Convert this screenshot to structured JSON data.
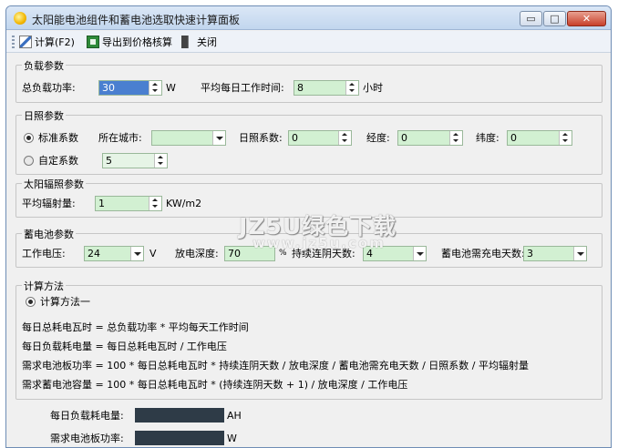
{
  "window": {
    "title": "太阳能电池组件和蓄电池选取快速计算面板"
  },
  "titlebar_buttons": {
    "minimize": "▭",
    "maximize": "□",
    "close": "✕"
  },
  "toolbar": {
    "calc_label": "计算(F2)",
    "export_label": "导出到价格核算",
    "close_label": "关闭",
    "icons": [
      "calculate-icon",
      "excel-icon",
      "exit-icon"
    ]
  },
  "load": {
    "title": "负载参数",
    "power_label": "总负载功率:",
    "power_value": "30",
    "power_unit": "W",
    "hours_label": "平均每日工作时间:",
    "hours_value": "8",
    "hours_unit": "小时"
  },
  "sun": {
    "title": "日照参数",
    "standard_label": "标准系数",
    "city_label": "所在城市:",
    "city_value": "",
    "coef_label": "日照系数:",
    "coef_value": "0",
    "lon_label": "经度:",
    "lon_value": "0",
    "lat_label": "纬度:",
    "lat_value": "0",
    "custom_label": "自定系数",
    "custom_value": "5"
  },
  "radiation": {
    "title": "太阳辐照参数",
    "avg_label": "平均辐射量:",
    "avg_value": "1",
    "avg_unit": "KW/m2"
  },
  "battery": {
    "title": "蓄电池参数",
    "voltage_label": "工作电压:",
    "voltage_value": "24",
    "voltage_unit": "V",
    "depth_label": "放电深度:",
    "depth_value": "70",
    "depth_unit": "%",
    "cloudy_label": "持续连阴天数:",
    "cloudy_value": "4",
    "recharge_label": "蓄电池需充电天数:",
    "recharge_value": "3"
  },
  "method": {
    "title": "计算方法",
    "option_label": "计算方法一",
    "formulas": [
      "每日总耗电瓦时 = 总负载功率 * 平均每天工作时间",
      "每日负载耗电量 = 每日总耗电瓦时 / 工作电压",
      "需求电池板功率 = 100 * 每日总耗电瓦时 * 持续连阴天数 / 放电深度 / 蓄电池需充电天数 / 日照系数 / 平均辐射量",
      "需求蓄电池容量 = 100 * 每日总耗电瓦时 * (持续连阴天数 + 1) / 放电深度 / 工作电压"
    ]
  },
  "results": {
    "daily_label": "每日负载耗电量:",
    "daily_unit": "AH",
    "panel_label": "需求电池板功率:",
    "panel_unit": "W"
  },
  "watermark": {
    "main": "JZ5U绿色下载",
    "sub": "www.jz5u.com"
  }
}
